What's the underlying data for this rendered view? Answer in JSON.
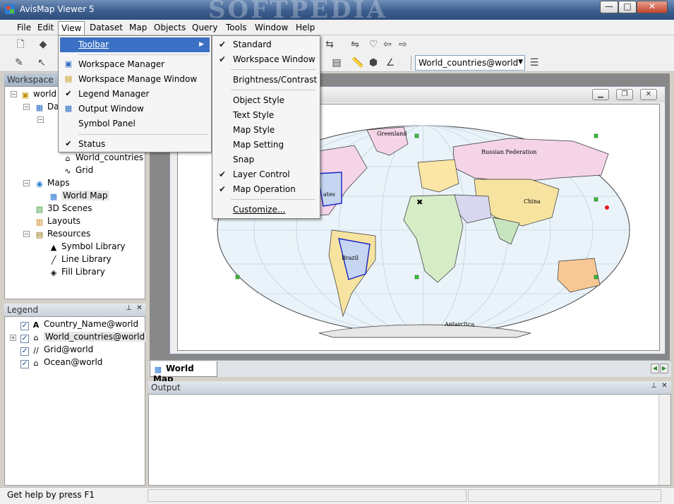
{
  "window": {
    "title": "AvisMap Viewer 5",
    "watermark": "SOFTPEDIA",
    "minimize_label": "—",
    "maximize_label": "□",
    "close_label": "✕"
  },
  "menubar": {
    "items": [
      "File",
      "Edit",
      "View",
      "Dataset",
      "Map",
      "Objects",
      "Query",
      "Tools",
      "Window",
      "Help"
    ]
  },
  "toolbar": {
    "layer_combo_value": "World_countries@world"
  },
  "view_menu": {
    "items": [
      {
        "label": "Toolbar",
        "checked": false,
        "has_submenu": true
      },
      {
        "label": "Workspace Manager",
        "checked": false
      },
      {
        "label": "Workspace Manage Window",
        "checked": false
      },
      {
        "label": "Legend Manager",
        "checked": true
      },
      {
        "label": "Output Window",
        "checked": false
      },
      {
        "label": "Symbol Panel",
        "checked": false
      },
      {
        "label": "Status",
        "checked": true
      }
    ]
  },
  "toolbar_submenu": {
    "items": [
      {
        "label": "Standard",
        "checked": true
      },
      {
        "label": "Workspace Window",
        "checked": true
      },
      {
        "label": "Brightness/Contrast",
        "checked": false
      },
      {
        "label": "Object Style",
        "checked": false
      },
      {
        "label": "Text Style",
        "checked": false
      },
      {
        "label": "Map Style",
        "checked": false
      },
      {
        "label": "Map Setting",
        "checked": false
      },
      {
        "label": "Snap",
        "checked": false
      },
      {
        "label": "Layer Control",
        "checked": true
      },
      {
        "label": "Map Operation",
        "checked": true
      },
      {
        "label": "Customize...",
        "checked": false
      }
    ]
  },
  "workspace": {
    "title": "Workspace",
    "tree": {
      "root": "world",
      "datasources_partial": "Da",
      "world_countries": "World_countries",
      "grid": "Grid",
      "maps": "Maps",
      "world_map": "World Map",
      "scenes": "3D Scenes",
      "layouts": "Layouts",
      "resources": "Resources",
      "symbol_library": "Symbol Library",
      "line_library": "Line Library",
      "fill_library": "Fill Library"
    }
  },
  "legend": {
    "title": "Legend",
    "items": [
      "Country_Name@world",
      "World_countries@world",
      "Grid@world",
      "Ocean@world"
    ]
  },
  "map_window": {
    "labels": {
      "greenland": "Greenland",
      "russia": "Russian Federation",
      "china": "China",
      "brazil": "Brazil",
      "antarctica": "Antarctica",
      "states": "ates"
    }
  },
  "doc_tab": {
    "label": "World Map"
  },
  "output": {
    "title": "Output"
  },
  "status": {
    "text": "Get help by press F1"
  }
}
